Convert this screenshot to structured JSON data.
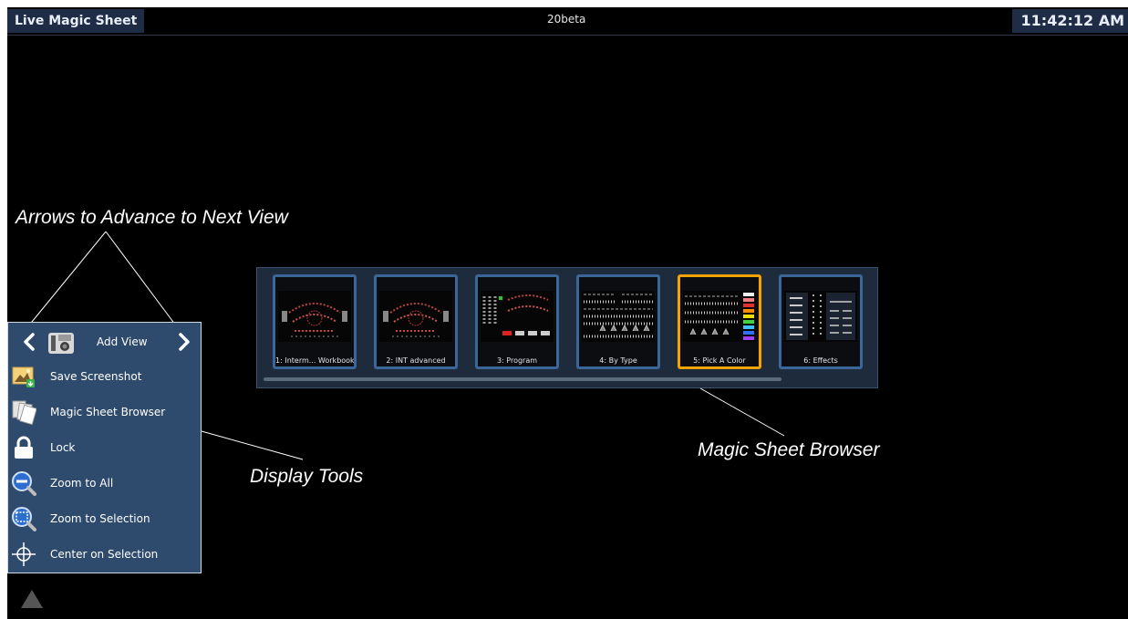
{
  "titlebar": {
    "app_title": "Live Magic Sheet",
    "version": "20beta",
    "clock": "11:42:12 AM"
  },
  "annotations": {
    "arrows": "Arrows to Advance to Next View",
    "display_tools": "Display Tools",
    "magic_sheet_browser": "Magic Sheet Browser"
  },
  "browser": {
    "thumbnails": [
      {
        "label": "1: Interm... Workbook",
        "selected": false,
        "icon": "stage-plot-thumbnail"
      },
      {
        "label": "2: INT advanced",
        "selected": false,
        "icon": "stage-plot-thumbnail"
      },
      {
        "label": "3: Program",
        "selected": false,
        "icon": "program-thumbnail"
      },
      {
        "label": "4: By Type",
        "selected": false,
        "icon": "type-grid-thumbnail"
      },
      {
        "label": "5: Pick A Color",
        "selected": true,
        "icon": "color-picker-thumbnail"
      },
      {
        "label": "6: Effects",
        "selected": false,
        "icon": "effects-thumbnail"
      }
    ],
    "selected_color": "#f5a300"
  },
  "tools": {
    "add_view": "Add View",
    "items": [
      {
        "label": "Save Screenshot",
        "icon": "screenshot-icon"
      },
      {
        "label": "Magic Sheet Browser",
        "icon": "pages-icon"
      },
      {
        "label": "Lock",
        "icon": "lock-icon"
      },
      {
        "label": "Zoom to All",
        "icon": "zoom-out-icon"
      },
      {
        "label": "Zoom to Selection",
        "icon": "zoom-selection-icon"
      },
      {
        "label": "Center on Selection",
        "icon": "crosshair-icon"
      }
    ]
  },
  "colors": {
    "panel": "#2e4a6d",
    "title_bg": "#1e2d45",
    "thumb_border": "#3a6698"
  }
}
